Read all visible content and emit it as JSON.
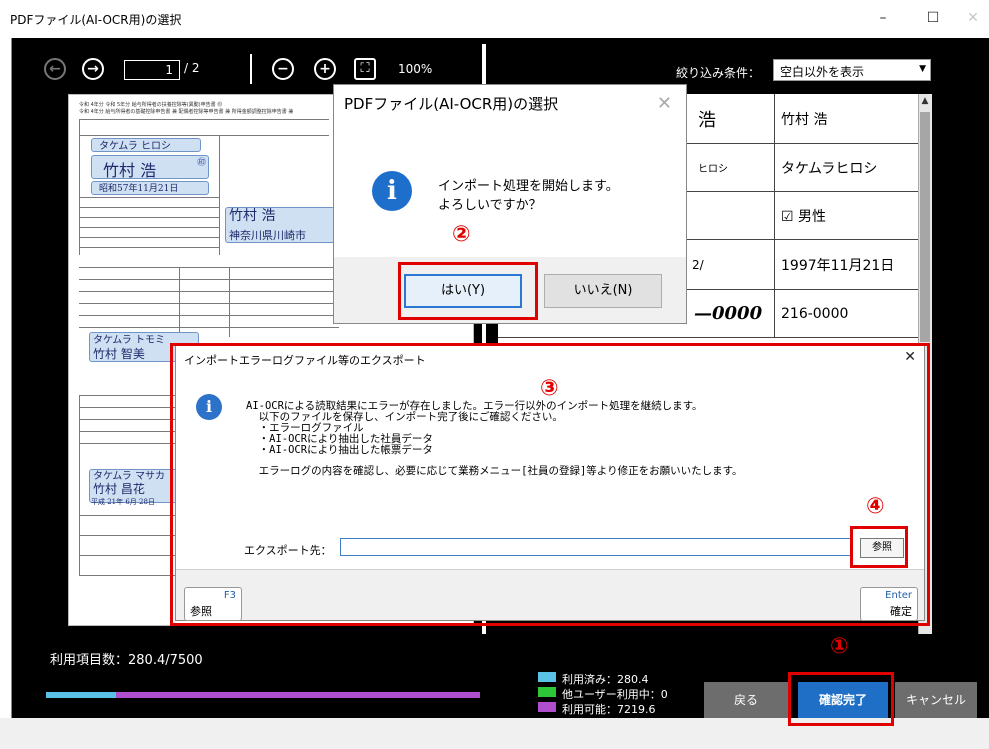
{
  "window": {
    "title": "PDFファイル(AI-OCR用)の選択",
    "minimize_glyph": "–",
    "maximize_glyph": "☐",
    "close_glyph": "✕"
  },
  "toolbar": {
    "back_icon": "arrow-left-circle",
    "forward_icon": "arrow-right-circle",
    "back_glyph": "←",
    "forward_glyph": "→",
    "page_current": "1",
    "page_total": "/ 2",
    "zoom_out_glyph": "−",
    "zoom_in_glyph": "+",
    "fit_glyph": "⛶",
    "zoom": "100%"
  },
  "document": {
    "header_line1": "令和 4年分 令和 5年分 給与所得者の扶養控除等(異動)申告書 ㊞",
    "header_line2": "令和 4年分 給与所得者の基礎控除申告書 兼 配偶者控除等申告書 兼 所得金額調整控除申告書 兼",
    "kana_name": "タケムラ ヒロシ",
    "name": "竹村 浩",
    "birth": "昭和57年11月21日",
    "name2": "竹村 浩",
    "address": "神奈川県川崎市",
    "kana_dependent": "タケムラ トモミ",
    "dependent": "竹村 智美",
    "kana_dependent2": "タケムラ マサカ",
    "dependent2": "竹村 昌花",
    "date2": "平成 21年 6月 28日",
    "stamp": "㊞"
  },
  "filter": {
    "label": "絞り込み条件：",
    "value": "空白以外を表示"
  },
  "grid_rows": [
    {
      "img_text": "浩",
      "value": "竹村 浩"
    },
    {
      "img_text": "ヒロシ",
      "value": "タケムラヒロシ"
    },
    {
      "img_text": "",
      "value": "☑ 男性"
    },
    {
      "img_text": "2/",
      "value": "1997年11月21日"
    },
    {
      "img_text": "—0000",
      "value": "216-0000"
    }
  ],
  "usage": {
    "label": "利用項目数：280.4/7500",
    "used_fraction": 0.0374,
    "legend": [
      {
        "label": "利用済み：280.4",
        "color": "#5bc2e7"
      },
      {
        "label": "他ユーザー利用中：0",
        "color": "#2ec73a"
      },
      {
        "label": "利用可能：7219.6",
        "color": "#b04fcd"
      }
    ]
  },
  "buttons": {
    "back": "戻る",
    "confirm": "確認完了",
    "cancel": "キャンセル"
  },
  "export_dialog": {
    "title": "インポートエラーログファイル等のエクスポート",
    "close_glyph": "✕",
    "message": [
      "AI-OCRによる読取結果にエラーが存在しました。エラー行以外のインポート処理を継続します。",
      "  以下のファイルを保存し、インポート完了後にご確認ください。",
      "  ・エラーログファイル",
      "  ・AI-OCRにより抽出した社員データ",
      "  ・AI-OCRにより抽出した帳票データ",
      "",
      "  エラーログの内容を確認し、必要に応じて業務メニュー[社員の登録]等より修正をお願いいたします。"
    ],
    "path_label": "エクスポート先：",
    "path_value": "",
    "browse": "参照",
    "f3_key": "F3",
    "f3_label": "参照",
    "enter_key": "Enter",
    "enter_label": "確定"
  },
  "msgbox": {
    "title": "PDFファイル(AI-OCR用)の選択",
    "close_glyph": "✕",
    "line1": "インポート処理を開始します。",
    "line2": "よろしいですか？",
    "yes": "はい(Y)",
    "no": "いいえ(N)"
  },
  "annotations": {
    "n1": "①",
    "n2": "②",
    "n3": "③",
    "n4": "④",
    "color": "#e00000"
  }
}
